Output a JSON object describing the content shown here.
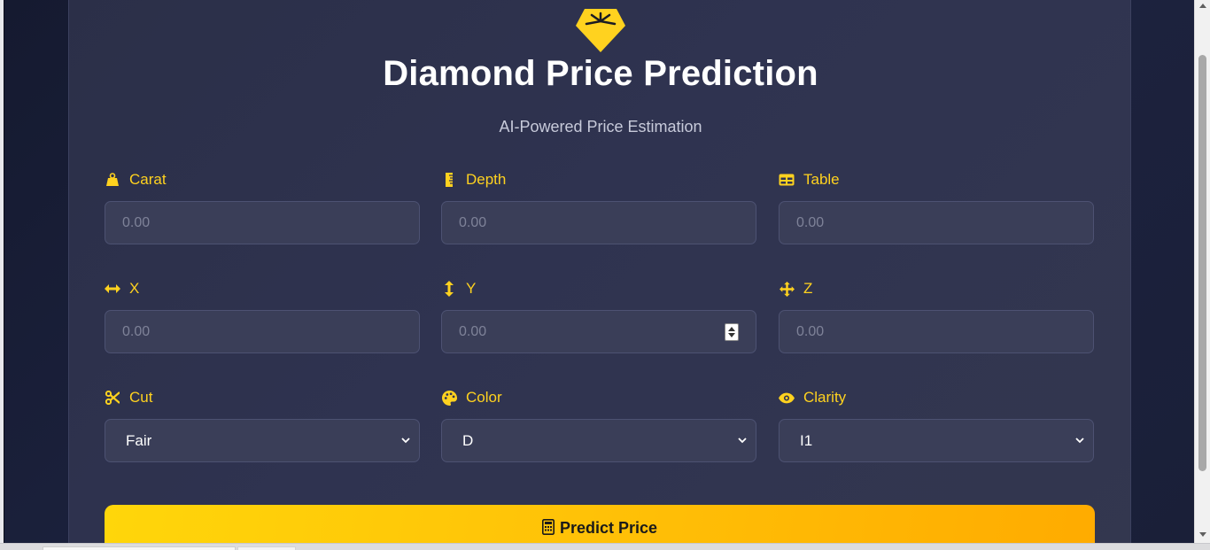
{
  "header": {
    "title": "Diamond Price Prediction",
    "subtitle": "AI-Powered Price Estimation"
  },
  "fields": {
    "carat": {
      "label": "Carat",
      "placeholder": "0.00",
      "icon": "weight-icon"
    },
    "depth": {
      "label": "Depth",
      "placeholder": "0.00",
      "icon": "ruler-icon"
    },
    "table": {
      "label": "Table",
      "placeholder": "0.00",
      "icon": "table-icon"
    },
    "x": {
      "label": "X",
      "placeholder": "0.00",
      "icon": "arrows-horizontal-icon"
    },
    "y": {
      "label": "Y",
      "placeholder": "0.00",
      "icon": "arrows-vertical-icon"
    },
    "z": {
      "label": "Z",
      "placeholder": "0.00",
      "icon": "arrows-move-icon"
    },
    "cut": {
      "label": "Cut",
      "selected": "Fair",
      "icon": "scissors-icon"
    },
    "color": {
      "label": "Color",
      "selected": "D",
      "icon": "palette-icon"
    },
    "clarity": {
      "label": "Clarity",
      "selected": "I1",
      "icon": "eye-icon"
    }
  },
  "actions": {
    "predict_label": "Predict Price",
    "predict_icon": "calculator-icon"
  },
  "colors": {
    "accent": "#ffd21f",
    "card": "#2f3350",
    "background": "#1a1f38"
  }
}
